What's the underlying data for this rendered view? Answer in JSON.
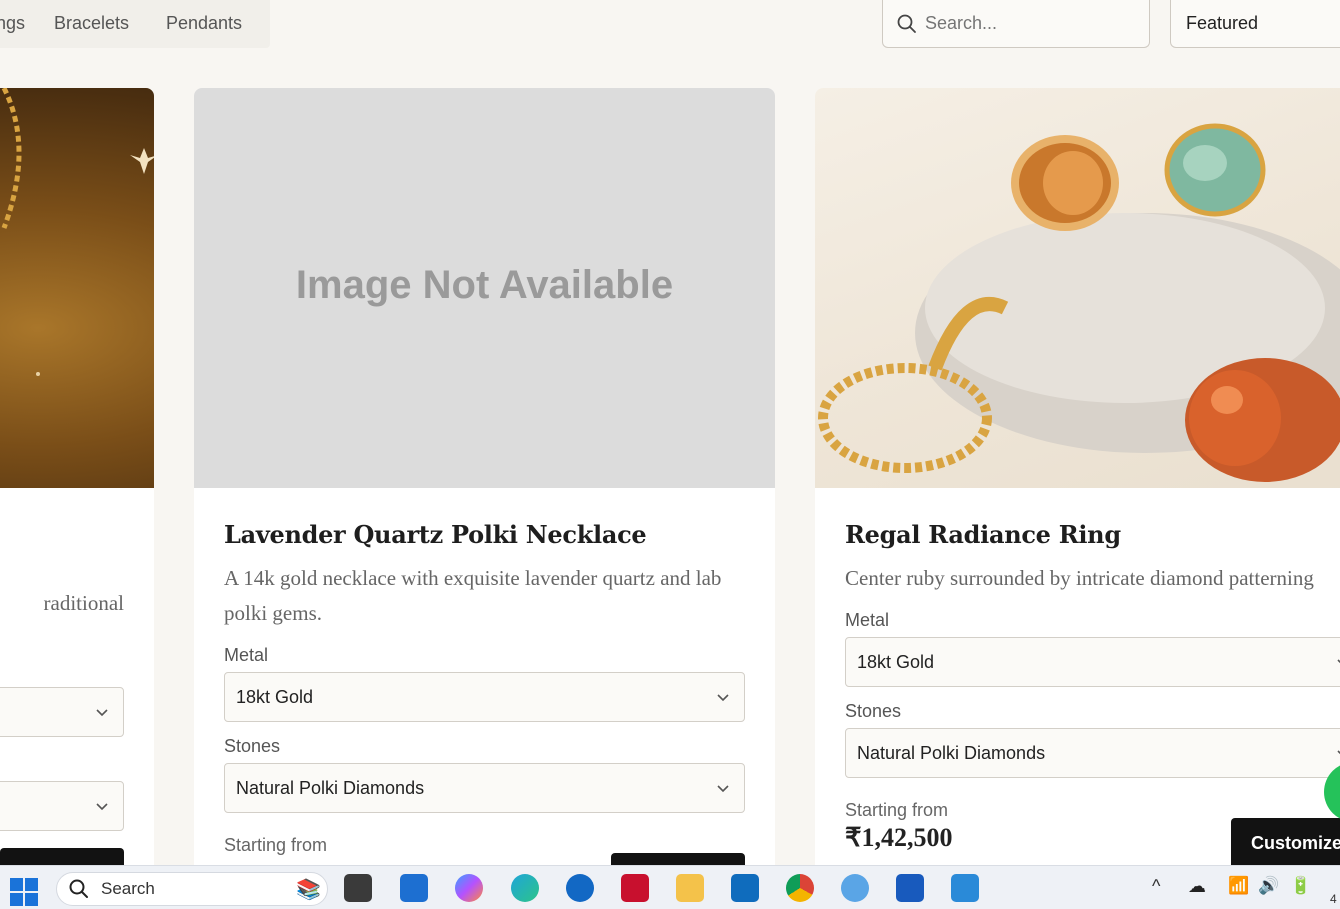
{
  "nav": {
    "categories": [
      "ngs",
      "Bracelets",
      "Pendants"
    ]
  },
  "search": {
    "placeholder": "Search..."
  },
  "sort": {
    "selected": "Featured"
  },
  "cards": [
    {
      "title": "",
      "description_fragment": "raditional",
      "metal": "",
      "stones": ""
    },
    {
      "title": "Lavender Quartz Polki Necklace",
      "description": "A 14k gold necklace with exquisite lavender quartz and lab polki gems.",
      "image_text": "Image Not Available",
      "metal_label": "Metal",
      "metal": "18kt Gold",
      "stones_label": "Stones",
      "stones": "Natural Polki Diamonds",
      "starting_label": "Starting from"
    },
    {
      "title": "Regal Radiance Ring",
      "description": "Center ruby surrounded by intricate diamond patterning",
      "metal_label": "Metal",
      "metal": "18kt Gold",
      "stones_label": "Stones",
      "stones": "Natural Polki Diamonds",
      "starting_label": "Starting from",
      "price": "₹1,42,500",
      "customize_label": "Customize"
    }
  ],
  "taskbar": {
    "search_label": "Search",
    "clock_fragment": "4"
  },
  "colors": {
    "background": "#f8f6f2",
    "card": "#ffffff",
    "button": "#121212",
    "placeholder_image": "#dcdcdc"
  }
}
